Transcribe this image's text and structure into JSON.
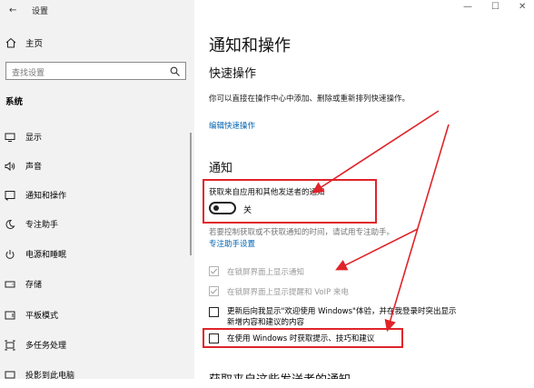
{
  "window": {
    "back_glyph": "←",
    "title": "设置",
    "controls": [
      "—",
      "☐",
      "✕"
    ]
  },
  "sidebar": {
    "home": "主页",
    "search_placeholder": "查找设置",
    "section": "系统",
    "items": [
      {
        "label": "显示",
        "icon": "monitor-icon"
      },
      {
        "label": "声音",
        "icon": "speaker-icon"
      },
      {
        "label": "通知和操作",
        "icon": "notification-icon"
      },
      {
        "label": "专注助手",
        "icon": "moon-icon"
      },
      {
        "label": "电源和睡眠",
        "icon": "power-icon"
      },
      {
        "label": "存储",
        "icon": "storage-icon"
      },
      {
        "label": "平板模式",
        "icon": "tablet-icon"
      },
      {
        "label": "多任务处理",
        "icon": "multitask-icon"
      },
      {
        "label": "投影到此电脑",
        "icon": "project-icon"
      }
    ]
  },
  "main": {
    "title": "通知和操作",
    "quick_actions": {
      "heading": "快速操作",
      "description": "你可以直接在操作中心中添加、删除或重新排列快速操作。",
      "edit_link": "编辑快速操作"
    },
    "notifications": {
      "heading": "通知",
      "toggle_label": "获取来自应用和其他发送者的通知",
      "toggle_state": "关",
      "toggle_on": false,
      "hint": "若要控制获取或不获取通知的时间，请试用专注助手。",
      "focus_link": "专注助手设置",
      "options": [
        {
          "label": "在锁屏界面上显示通知",
          "checked": true,
          "disabled": true
        },
        {
          "label": "在锁屏界面上显示提醒和 VoIP 来电",
          "checked": true,
          "disabled": true
        },
        {
          "label_line1": "更新后向我显示\"欢迎使用 Windows\"体验，并在我登录时突出显示",
          "label_line2": "新增内容和建议的内容",
          "checked": false,
          "disabled": false
        },
        {
          "label": "在使用 Windows 时获取提示、技巧和建议",
          "checked": false,
          "disabled": false
        }
      ],
      "next_heading_cut": "获取来自这些发送者的通知"
    }
  },
  "colors": {
    "accent": "#0063b1",
    "annotation": "#e0242a",
    "sidebar_bg": "#f2f2f2"
  }
}
